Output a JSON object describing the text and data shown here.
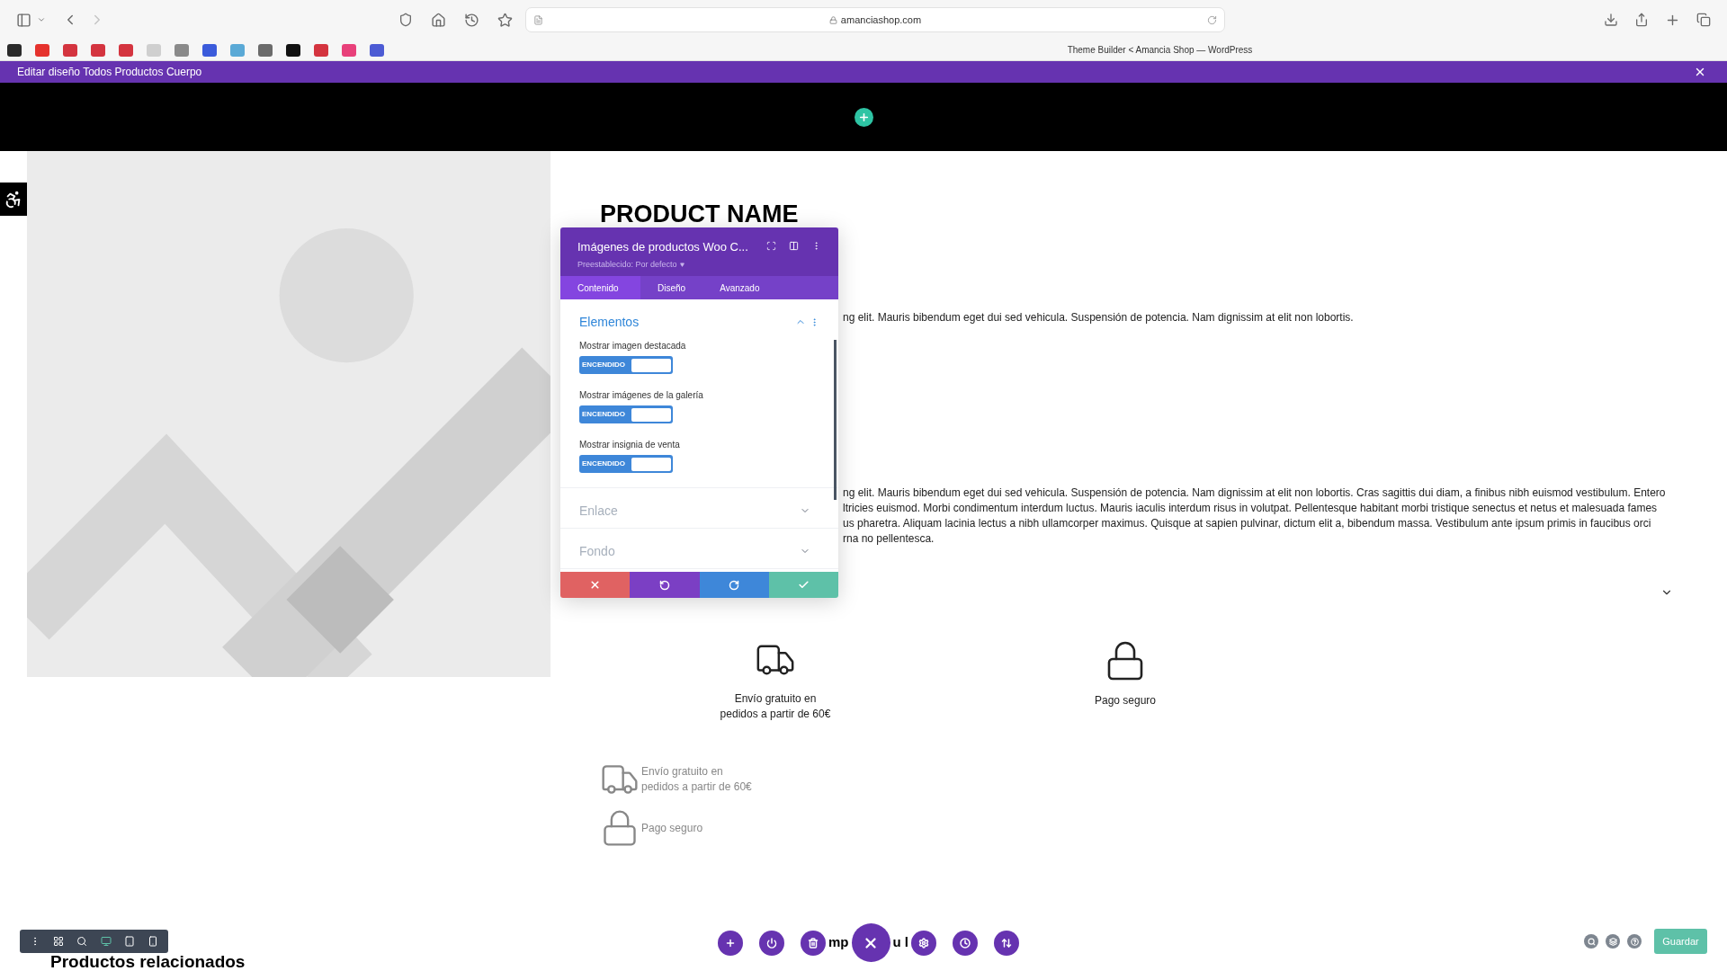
{
  "browser": {
    "address": "amanciashop.com",
    "tab_title": "Theme Builder < Amancia Shop — WordPress",
    "bookmarks": [
      {
        "color": "#2b2b2b"
      },
      {
        "color": "#e5322d"
      },
      {
        "color": "#d4343f"
      },
      {
        "color": "#d4343f"
      },
      {
        "color": "#d4343f"
      },
      {
        "color": "#cfcfcf"
      },
      {
        "color": "#8a8a8a"
      },
      {
        "color": "#3b5bdb"
      },
      {
        "color": "#5aa9d6"
      },
      {
        "color": "#6b6b6b"
      },
      {
        "color": "#111111"
      },
      {
        "color": "#d4343f"
      },
      {
        "color": "#e8407a"
      },
      {
        "color": "#4c5bd4"
      }
    ]
  },
  "builder_bar": {
    "title": "Editar diseño Todos Productos Cuerpo"
  },
  "product": {
    "name": "PRODUCT NAME",
    "short_description": [
      "ng elit. Mauris bibendum eget dui sed vehicula. Suspensión de potencia. Nam dignissim at elit non lobortis."
    ],
    "description": [
      "ng elit. Mauris bibendum eget dui sed vehicula. Suspensión de potencia. Nam dignissim at elit non lobortis. Cras sagittis dui diam, a finibus nibh euismod vestibulum. Entero",
      "ltricies euismod. Morbi condimentum interdum luctus. Mauris iaculis interdum risus in volutpat. Pellentesque habitant morbi tristique senectus et netus et malesuada fames",
      "us pharetra. Aliquam lacinia lectus a nibh ullamcorper maximus. Quisque at sapien pulvinar, dictum elit a, bibendum massa. Vestibulum ante ipsum primis in faucibus orci",
      "rna no pellentesca."
    ],
    "features": [
      {
        "kind": "truck",
        "lines": [
          "Envío gratuito en",
          "pedidos a partir de 60€"
        ]
      },
      {
        "kind": "lock",
        "lines": [
          "Pago seguro"
        ]
      }
    ],
    "feature_list": [
      {
        "kind": "truck",
        "lines": [
          "Envío gratuito en",
          "pedidos a partir de 60€"
        ]
      },
      {
        "kind": "lock",
        "lines": [
          "Pago seguro"
        ]
      }
    ]
  },
  "related_heading": "Productos relacionados",
  "hidden_heading_fragments": [
    "mp",
    "u l"
  ],
  "settings_panel": {
    "title": "Imágenes de productos Woo C...",
    "preset": "Preestablecido: Por defecto",
    "tabs": [
      {
        "label": "Contenido",
        "selected": true
      },
      {
        "label": "Diseño",
        "selected": false
      },
      {
        "label": "Avanzado",
        "selected": false
      }
    ],
    "sections": [
      {
        "title": "Elementos",
        "expanded": true,
        "options": [
          {
            "label": "Mostrar imagen destacada",
            "on": true,
            "state_text": "ENCENDIDO"
          },
          {
            "label": "Mostrar imágenes de la galería",
            "on": true,
            "state_text": "ENCENDIDO"
          },
          {
            "label": "Mostrar insignia de venta",
            "on": true,
            "state_text": "ENCENDIDO"
          }
        ]
      },
      {
        "title": "Enlace",
        "expanded": false
      },
      {
        "title": "Fondo",
        "expanded": false
      }
    ]
  },
  "save_button": "Guardar"
}
